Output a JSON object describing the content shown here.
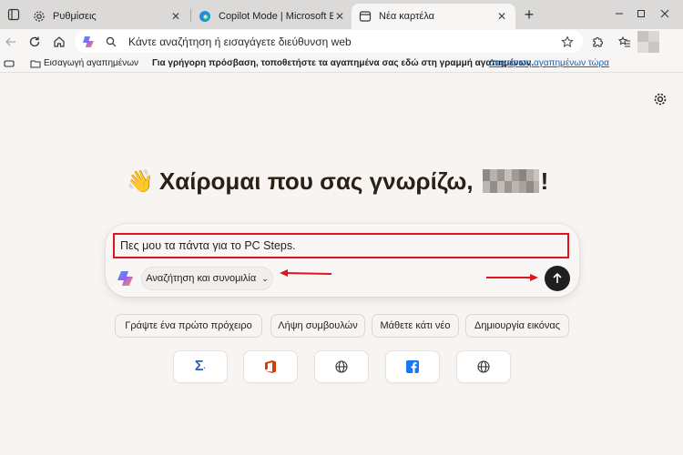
{
  "tabs": [
    {
      "title": "Ρυθμίσεις",
      "icon": "gear-icon"
    },
    {
      "title": "Copilot Mode | Microsoft Edge",
      "icon": "edge-icon"
    },
    {
      "title": "Νέα καρτέλα",
      "icon": "newtab-icon",
      "active": true
    }
  ],
  "address_bar": {
    "placeholder": "Κάντε αναζήτηση ή εισαγάγετε διεύθυνση web"
  },
  "favorites_bar": {
    "import_label": "Εισαγωγή αγαπημένων",
    "message": "Για γρήγορη πρόσβαση, τοποθετήστε τα αγαπημένα σας εδώ στη γραμμή αγαπημένων.",
    "manage_link": "Διαχείριση αγαπημένων τώρα"
  },
  "greeting": {
    "emoji": "👋",
    "text": "Χαίρομαι που σας γνωρίζω,",
    "suffix": "!"
  },
  "chat": {
    "input_value": "Πες μου τα πάντα για το PC Steps.",
    "mode_label": "Αναζήτηση και συνομιλία"
  },
  "suggestions": [
    "Γράψτε ένα πρώτο πρόχειρο",
    "Λήψη συμβουλών",
    "Μάθετε κάτι νέο",
    "Δημιουργία εικόνας"
  ],
  "quick_links": [
    "sigma-icon",
    "office-icon",
    "globe-icon",
    "facebook-icon",
    "globe-icon"
  ],
  "colors": {
    "highlight_red": "#e0141e",
    "send_button": "#1f1f1f",
    "link_blue": "#1a62b8"
  }
}
